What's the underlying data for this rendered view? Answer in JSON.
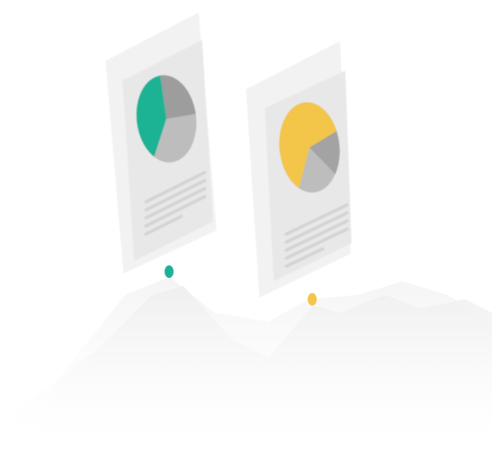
{
  "illustration": {
    "colors": {
      "background": "#ffffff",
      "card_back": "#f1f1f1",
      "card_front": "#e6e6e6",
      "pie_gray_light": "#bdbdbd",
      "pie_gray_dark": "#9a9a9a",
      "text_lines": "#d4d4d4",
      "left_accent": "#1bb394",
      "right_accent": "#f3c54a",
      "mountains": "#efefef",
      "mountains_light": "#f6f6f6"
    },
    "left_card": {
      "accent": "#1bb394",
      "pie": {
        "accent_fraction": 0.4
      },
      "text_line_count": 5,
      "marker_icon": "location-pin-icon"
    },
    "right_card": {
      "accent": "#f3c54a",
      "pie": {
        "accent_fraction": 0.62
      },
      "text_line_count": 5,
      "marker_icon": "location-pin-icon"
    }
  }
}
